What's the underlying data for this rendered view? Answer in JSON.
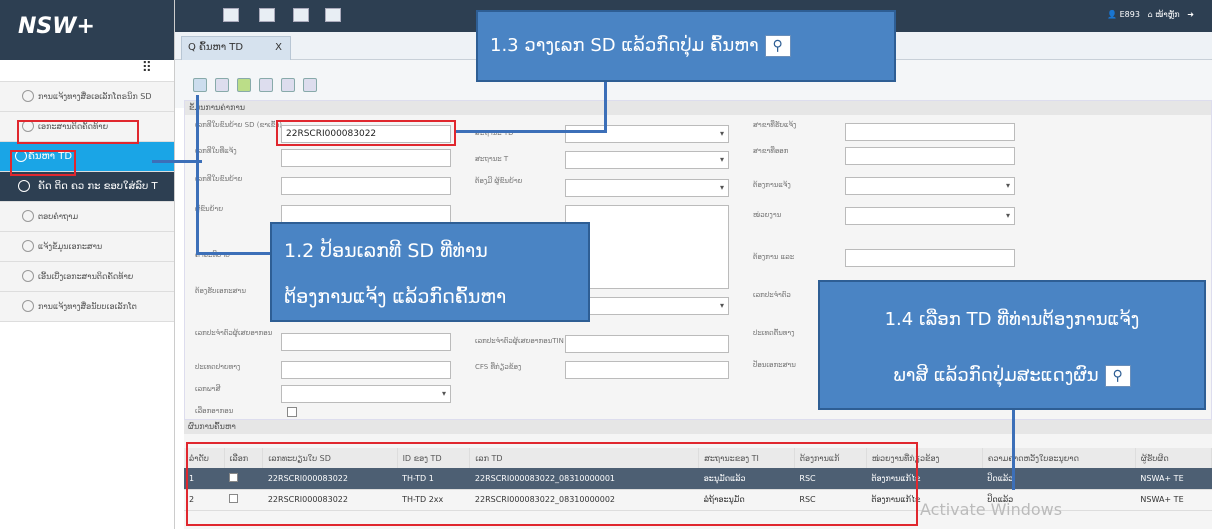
{
  "app": {
    "logo": "NSW+",
    "tab_title": "Q ຄົ້ນຫາ TD",
    "tab_close": "X",
    "user": "E893",
    "user2": "ໜ້າຫຼັກ",
    "grip": "⠿"
  },
  "sidebar": {
    "items": [
      {
        "label": "ການແຈ້ງທາງສື່ອເອເລັກໂຕຣນິກ SD"
      },
      {
        "label": "ເອກະສານຕິດຄັດທ້າຍ"
      },
      {
        "label": "ຄົ້ນຫາ TD"
      },
      {
        "label": "ຄັດ ຕິດ ຄວ ກະ ຂອບໃສ່ລົບ T"
      },
      {
        "label": "ຕອບຄໍາຖາມ"
      },
      {
        "label": "ແຈ້ງຂໍ້ມູນເອກະສານ"
      },
      {
        "label": "ເອີ້ນເບີ່ງເອກະສານຕິດຄັດທ້າຍ"
      },
      {
        "label": "ການແຈ້ງທາງສື່ອນັບບເອເລັກໂຕ"
      }
    ]
  },
  "form": {
    "section": "ຂໍ້ມູນການຄ່າການ",
    "labels": [
      "ເລກທີໃບຂົນຍ້າຍ SD (ຂາເຂົ້າ)",
      "ເລກທີໃບທີ່ແຈ້ງ",
      "ເລກທີໃບຂົນຍ້າຍ",
      "ຜູ້ຂົນຍ້າຍ",
      "ຄຳອະທິບາຍ",
      "ຕ້ອງຮັບເອກະສານ",
      "ເລກປະຈໍາຕົວຜູ້ເສຍອາກອນ",
      "ປະເທດປາຍທາງ",
      "ເລກພາສີ",
      "ເລືອກອາກອນ"
    ],
    "labels_mid": [
      "ສະຖານະ TD",
      "ສະຖານະ T",
      "ຕ້ອງມີ ຜູ້ຂົນຍ້າຍ",
      "ເລກປະຈໍາຕົວຜູ້ເສຍອາກອນTIN",
      "CFS ທີ່ກ່ຽວຂ້ອງ"
    ],
    "labels_right": [
      "ສາຂາທີ່ຮັບແຈ້ງ",
      "ສາຂາທີ່ອອກ",
      "ຕ້ອງການແຈ້ງ",
      "ໜ່ວຍງານ",
      "ຕ້ອງການ ແລະ",
      "ເລກປະຈໍາຕົວ",
      "ປະເທດຕົ້ນທາງ",
      "ປ້ອນເອກະສານ"
    ],
    "sd_value": "22RSCRI000083022"
  },
  "grid": {
    "section": "ຜົນການຄົ້ນຫາ",
    "headers": [
      "ລຳດັບ",
      "ເລືອກ",
      "ເລກທະບຽນໃບ SD",
      "ID ຂອງ TD",
      "ເລກ TD",
      "ສະຖານະຂອງ TI",
      "ຕ້ອງການແກ້",
      "ໜ່ວຍງານທີ່ກ່ຽວຂ້ອງ",
      "ຄວາມຄາດຫວັງໃບອະນຸຍາດ",
      "ຜູ້ຮັບຜິດ"
    ],
    "rows": [
      [
        "1",
        "",
        "22RSCRI000083022",
        "TH-TD 1",
        "22RSCRI000083022_08310000001",
        "ອະນຸມັດແລ້ວ",
        "RSC",
        "ຕ້ອງການແກ້ໄຂ",
        "ປິດແລ້ວ",
        "NSWA+ TE"
      ],
      [
        "2",
        "",
        "22RSCRI000083022",
        "TH-TD 2xx",
        "22RSCRI000083022_08310000002",
        "ລໍຖ້າອະນຸມັດ",
        "RSC",
        "ຕ້ອງການແກ້ໄຂ",
        "ປິດແລ້ວ",
        "NSWA+ TE"
      ]
    ]
  },
  "callouts": {
    "c13": "1.3 ວາງເລກ SD ແລ້ວກົດປຸ່ມ ຄົ້ນຫາ",
    "c12a": "1.2 ປ້ອນເລກທີ SD ທີ່ທ່ານ",
    "c12b": "ຕ້ອງການແຈ້ງ ແລ້ວກົດຄົ້ນຫາ",
    "c14a": "1.4 ເລືອກ TD ທີ່ທ່ານຕ້ອງການແຈ້ງ",
    "c14b": "ພາສີ ແລ້ວກົດປຸ່ມສະແດງຜົນ"
  },
  "watermark": "Activate Windows",
  "colors": {
    "navy": "#2d3f52",
    "accent": "#1aa5e6",
    "callout": "#4a84c4",
    "highlight": "#e0272e"
  }
}
